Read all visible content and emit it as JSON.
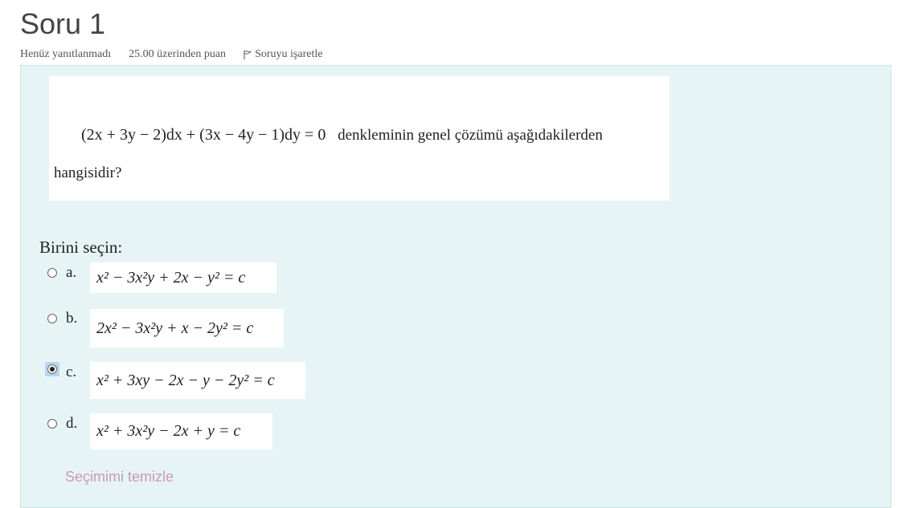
{
  "question": {
    "title": "Soru 1",
    "status": "Henüz yanıtlanmadı",
    "points": "25.00 üzerinden puan",
    "flag_label": "Soruyu işaretle",
    "equation": "(2x + 3y − 2)dx + (3x − 4y − 1)dy = 0",
    "text_line1": "denkleminin genel çözümü aşağıdakilerden",
    "text_line2": "hangisidir?"
  },
  "answer": {
    "prompt": "Birini seçin:",
    "options": [
      {
        "letter": "a.",
        "formula": "x² − 3x²y + 2x − y² = c",
        "selected": false
      },
      {
        "letter": "b.",
        "formula": "2x² − 3x²y + x − 2y² = c",
        "selected": false
      },
      {
        "letter": "c.",
        "formula": "x² + 3xy − 2x − y − 2y² = c",
        "selected": true
      },
      {
        "letter": "d.",
        "formula": "x² + 3x²y − 2x + y = c",
        "selected": false
      }
    ],
    "clear_label": "Seçimimi temizle"
  },
  "colors": {
    "panel_bg": "#e7f4f5",
    "clear_link": "#c79ab8",
    "selected_highlight": "#b7d7f0"
  }
}
